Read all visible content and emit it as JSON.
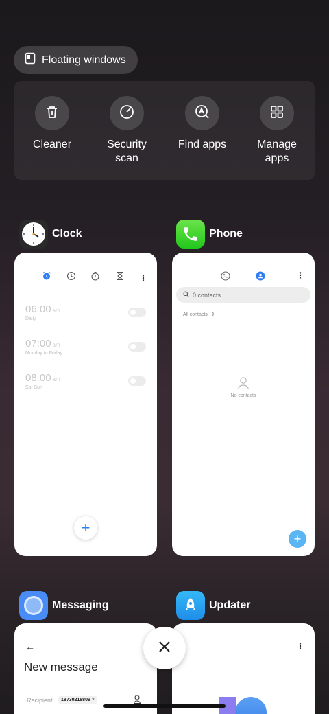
{
  "floating_windows": {
    "label": "Floating windows",
    "icon": "floating-window-icon"
  },
  "quick_actions": [
    {
      "label": "Cleaner",
      "icon": "trash-icon"
    },
    {
      "label": "Security\nscan",
      "icon": "security-scan-icon"
    },
    {
      "label": "Find apps",
      "icon": "find-apps-icon"
    },
    {
      "label": "Manage\napps",
      "icon": "grid-icon"
    }
  ],
  "recent_apps": {
    "clock": {
      "name": "Clock",
      "alarms": [
        {
          "time": "06:00",
          "ampm": "am",
          "repeat": "Daily"
        },
        {
          "time": "07:00",
          "ampm": "am",
          "repeat": "Monday to Friday"
        },
        {
          "time": "08:00",
          "ampm": "am",
          "repeat": "Sat Sun"
        }
      ]
    },
    "phone": {
      "name": "Phone",
      "search_placeholder": "0 contacts",
      "filter_label": "All contacts",
      "empty_label": "No contacts"
    },
    "messaging": {
      "name": "Messaging",
      "title": "New message",
      "recipient_label": "Recipient:",
      "recipient_chip": "18730218809"
    },
    "updater": {
      "name": "Updater"
    }
  },
  "colors": {
    "accent_blue": "#2f7ff2",
    "phone_green": "#3ed13a",
    "updater_blue": "#2a9bf3",
    "messaging_blue": "#4a8cf5"
  }
}
